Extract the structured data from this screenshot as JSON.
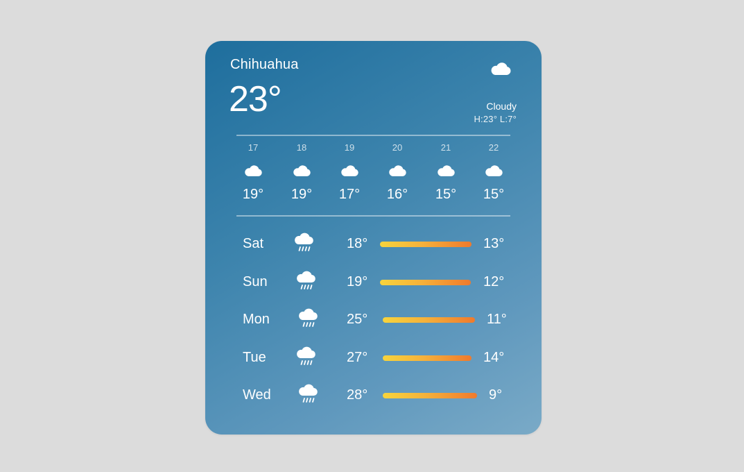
{
  "widget": {
    "city": "Chihuahua",
    "current_temp": "23°",
    "condition": "Cloudy",
    "hilo": "H:23° L:7°",
    "condition_icon": "cloud-icon"
  },
  "hourly": [
    {
      "label": "17",
      "icon": "cloud-icon",
      "temp": "19°"
    },
    {
      "label": "18",
      "icon": "cloud-icon",
      "temp": "19°"
    },
    {
      "label": "19",
      "icon": "cloud-icon",
      "temp": "17°"
    },
    {
      "label": "20",
      "icon": "cloud-icon",
      "temp": "16°"
    },
    {
      "label": "21",
      "icon": "cloud-icon",
      "temp": "15°"
    },
    {
      "label": "22",
      "icon": "cloud-icon",
      "temp": "15°"
    }
  ],
  "daily": [
    {
      "day": "Sat",
      "icon": "rain-cloud-icon",
      "high": "18°",
      "low": "13°"
    },
    {
      "day": "Sun",
      "icon": "rain-cloud-icon",
      "high": "19°",
      "low": "12°"
    },
    {
      "day": "Mon",
      "icon": "rain-cloud-icon",
      "high": "25°",
      "low": "11°"
    },
    {
      "day": "Tue",
      "icon": "rain-cloud-icon",
      "high": "27°",
      "low": "14°"
    },
    {
      "day": "Wed",
      "icon": "rain-cloud-icon",
      "high": "28°",
      "low": "9°"
    }
  ],
  "colors": {
    "background": "#dcdcdc",
    "widget_top": "#1e6e9d",
    "widget_bottom": "#7aaac7",
    "bar_start": "#f7d43c",
    "bar_end": "#f07a2c"
  }
}
